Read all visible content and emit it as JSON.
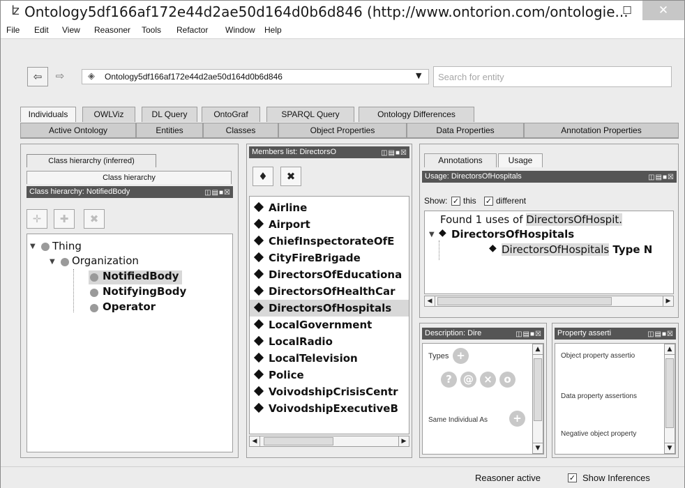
{
  "window": {
    "title": "Ontology5df166af172e44d2ae50d164d0b6d846 (http://www.ontorion.com/ontologie...",
    "minimize": "–",
    "maximize": "☐",
    "close": "✕"
  },
  "menu": [
    "File",
    "Edit",
    "View",
    "Reasoner",
    "Tools",
    "Refactor",
    "Window",
    "Help"
  ],
  "toolbar": {
    "back": "⇦",
    "forward": "⇨",
    "ontology": "Ontology5df166af172e44d2ae50d164d0b6d846",
    "search_placeholder": "Search for entity"
  },
  "tabs_row1": [
    "Individuals",
    "OWLViz",
    "DL Query",
    "OntoGraf",
    "SPARQL Query",
    "Ontology Differences"
  ],
  "tabs_row2": [
    "Active Ontology",
    "Entities",
    "Classes",
    "Object Properties",
    "Data Properties",
    "Annotation Properties"
  ],
  "class_panel": {
    "tab_inferred": "Class hierarchy (inferred)",
    "tab_asserted": "Class hierarchy",
    "header": "Class hierarchy: NotifiedBody",
    "tree": {
      "root": "Thing",
      "child": "Organization",
      "leaves": [
        "NotifiedBody",
        "NotifyingBody",
        "Operator"
      ]
    }
  },
  "members_panel": {
    "header": "Members list: DirectorsO",
    "items": [
      "Airline",
      "Airport",
      "ChiefInspectorateOfE",
      "CityFireBrigade",
      "DirectorsOfEducationa",
      "DirectorsOfHealthCar",
      "DirectorsOfHospitals",
      "LocalGovernment",
      "LocalRadio",
      "LocalTelevision",
      "Police",
      "VoivodshipCrisisCentr",
      "VoivodshipExecutiveB"
    ],
    "selected": "DirectorsOfHospitals"
  },
  "usage_panel": {
    "tab_annotations": "Annotations",
    "tab_usage": "Usage",
    "header": "Usage: DirectorsOfHospitals",
    "show_label": "Show:",
    "this_label": "this",
    "different_label": "different",
    "found_prefix": "Found 1 uses of ",
    "found_entity": "DirectorsOfHospit.",
    "tree_root": "DirectorsOfHospitals",
    "tree_child": "DirectorsOfHospitals",
    "tree_child_suffix": " Type N"
  },
  "description_panel": {
    "header": "Description: Dire",
    "types_label": "Types",
    "same_label": "Same Individual As"
  },
  "property_panel": {
    "header": "Property asserti",
    "object_label": "Object property assertio",
    "data_label": "Data property assertions",
    "negative_label": "Negative object property"
  },
  "status": {
    "reasoner": "Reasoner active",
    "show_inferences": "Show Inferences"
  }
}
